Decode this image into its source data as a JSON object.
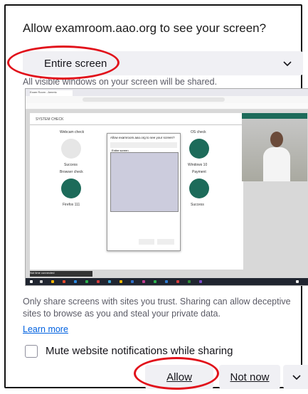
{
  "dialog": {
    "title": "Allow examroom.aao.org to see your screen?",
    "select": {
      "value": "Entire screen",
      "icon": "chevron-down-icon"
    },
    "hint": "All visible windows on your screen will be shared.",
    "preview": {
      "tab_label": "Exam Room - Americ",
      "system_check": "SYSTEM CHECK",
      "inner_dialog_title": "Allow examroom.aao.org to see your screen?",
      "inner_select": "Entire screen",
      "status_bar": "Not time connected",
      "cap_webcam": "Webcam check",
      "cap_browser": "Browser check",
      "cap_success": "Success",
      "cap_firefox": "Firefox 111",
      "cap_os": "OS check",
      "cap_windows": "Windows 10",
      "cap_payment": "Payment",
      "cap_success2": "Success"
    },
    "warning": "Only share screens with sites you trust. Sharing can allow deceptive sites to browse as you and steal your private data.",
    "learn_more": "Learn more",
    "checkbox_label": "Mute website notifications while sharing",
    "buttons": {
      "allow": "Allow",
      "not_now": "Not now",
      "more_icon": "chevron-down-icon"
    }
  },
  "colors": {
    "annotation_red": "#e1101a",
    "link": "#0061e0",
    "button_bg": "#f0f0f4"
  }
}
